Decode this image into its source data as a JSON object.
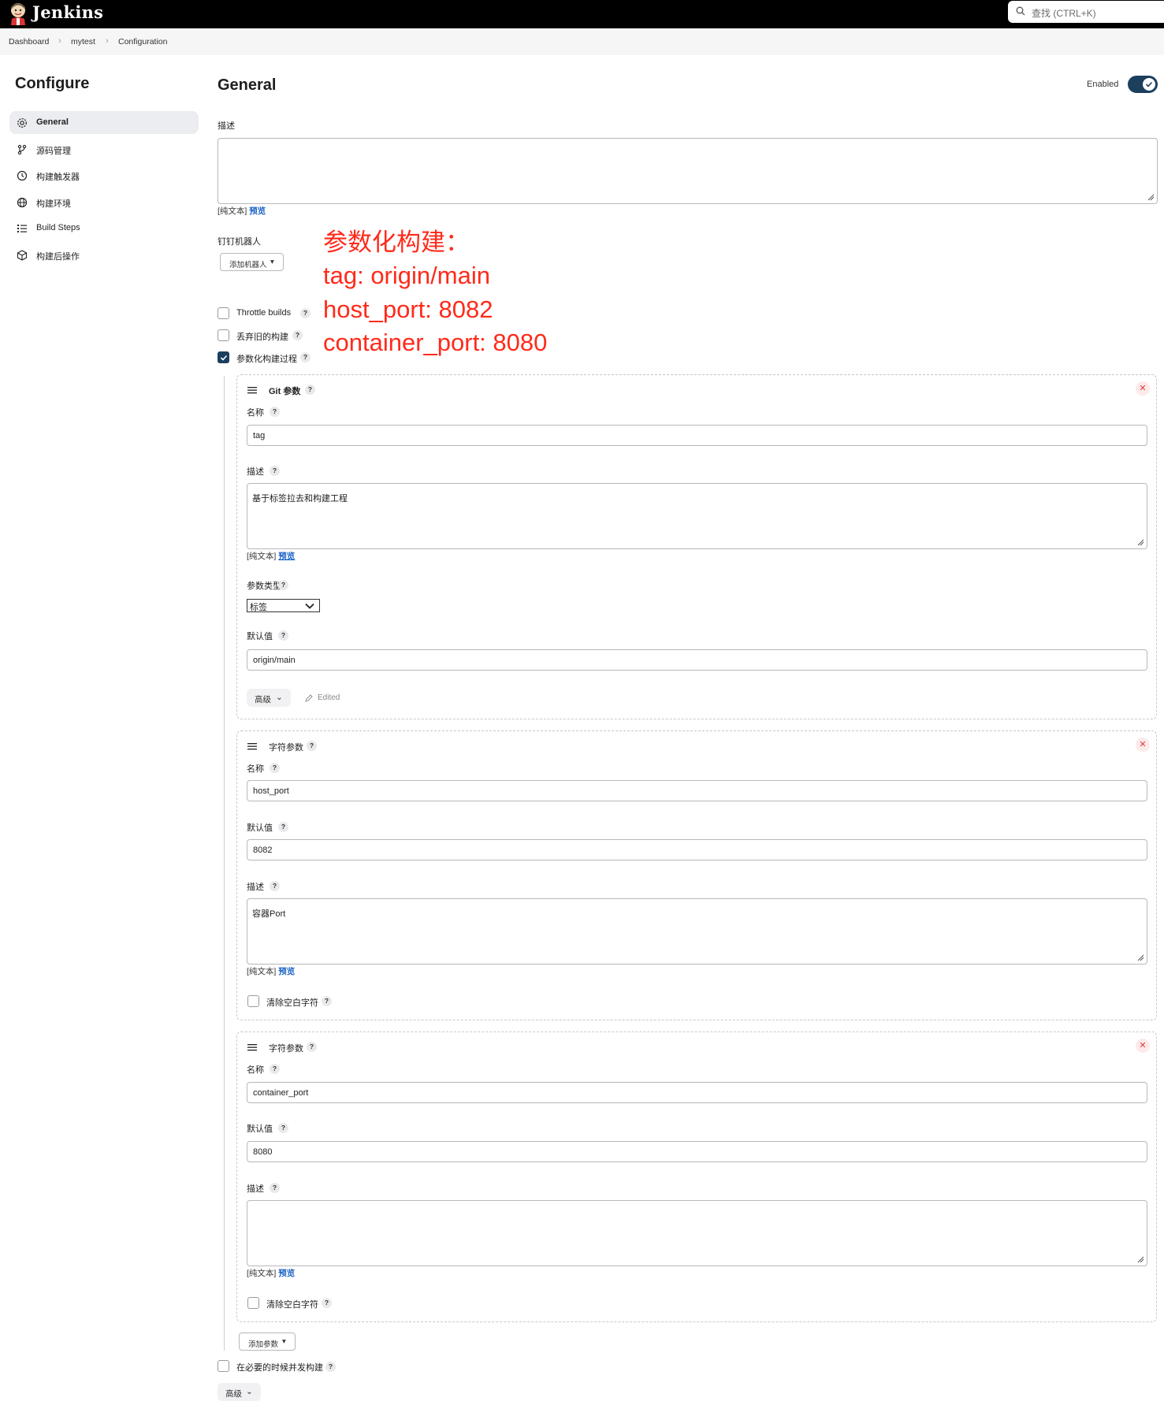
{
  "header": {
    "brand": "Jenkins",
    "search_placeholder": "查找 (CTRL+K)"
  },
  "breadcrumb": [
    "Dashboard",
    "mytest",
    "Configuration"
  ],
  "sidebar": {
    "title": "Configure",
    "items": [
      {
        "label": "General",
        "icon": "gear-icon",
        "active": true
      },
      {
        "label": "源码管理",
        "icon": "branch-icon"
      },
      {
        "label": "构建触发器",
        "icon": "clock-icon"
      },
      {
        "label": "构建环境",
        "icon": "globe-icon"
      },
      {
        "label": "Build Steps",
        "icon": "list-icon"
      },
      {
        "label": "构建后操作",
        "icon": "cube-icon"
      }
    ]
  },
  "general": {
    "title": "General",
    "enabled_label": "Enabled",
    "enabled": true,
    "description_label": "描述",
    "description_value": "",
    "plain_text": "[纯文本]",
    "preview": "预览",
    "dingtalk_label": "钉钉机器人",
    "add_robot": "添加机器人",
    "options": [
      {
        "label": "Throttle builds",
        "checked": false
      },
      {
        "label": "丢弃旧的构建",
        "checked": false
      },
      {
        "label": "参数化构建过程",
        "checked": true
      }
    ],
    "concurrent_label": "在必要的时候并发构建",
    "advanced": "高级",
    "add_param": "添加参数"
  },
  "annotation": [
    "参数化构建：",
    "tag: origin/main",
    "host_port: 8082",
    "container_port: 8080"
  ],
  "params": [
    {
      "title": "Git 参数",
      "name_label": "名称",
      "name": "tag",
      "desc_label": "描述",
      "desc": "基于标签拉去和构建工程",
      "type_label": "参数类型",
      "type": "标签",
      "default_label": "默认值",
      "default": "origin/main",
      "advanced": "高级",
      "edited": "Edited"
    },
    {
      "title": "字符参数",
      "name_label": "名称",
      "name": "host_port",
      "default_label": "默认值",
      "default": "8082",
      "desc_label": "描述",
      "desc": "容器Port",
      "trim_label": "清除空白字符"
    },
    {
      "title": "字符参数",
      "name_label": "名称",
      "name": "container_port",
      "default_label": "默认值",
      "default": "8080",
      "desc_label": "描述",
      "desc": "",
      "trim_label": "清除空白字符"
    }
  ],
  "colors": {
    "accent": "#1c3f5e",
    "link": "#1a62c4",
    "annotation": "#ff2a1a",
    "close": "#e0383e"
  }
}
